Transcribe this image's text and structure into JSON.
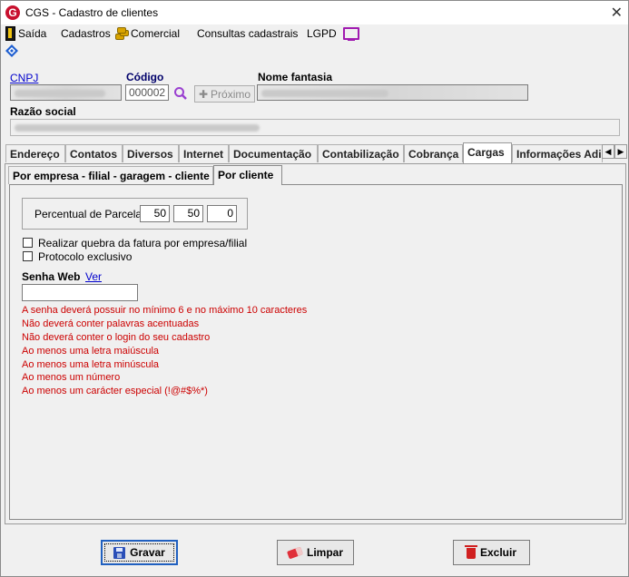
{
  "window": {
    "title": "CGS - Cadastro de clientes",
    "close_glyph": "✕",
    "logo_letter": "G"
  },
  "menu": {
    "items": [
      {
        "label": "Saída",
        "icon": "door-exit-icon"
      },
      {
        "label": "Cadastros"
      },
      {
        "label": "Comercial",
        "icon": "coins-icon"
      },
      {
        "label": "Consultas cadastrais"
      },
      {
        "label": "LGPD",
        "icon": "monitor-icon"
      }
    ]
  },
  "header": {
    "cnpj_label": "CNPJ",
    "codigo_label": "Código",
    "codigo_value": "000002",
    "proximo_label": "Próximo",
    "nome_fantasia_label": "Nome fantasia",
    "razao_social_label": "Razão social"
  },
  "tabs": {
    "items": [
      "Endereço",
      "Contatos",
      "Diversos",
      "Internet",
      "Documentação",
      "Contabilização",
      "Cobrança",
      "Cargas",
      "Informações Adi"
    ],
    "active": "Cargas",
    "scroll_left": "◀",
    "scroll_right": "▶"
  },
  "subtabs": {
    "items": [
      "Por empresa - filial - garagem - cliente",
      "Por cliente"
    ],
    "active": "Por cliente"
  },
  "cargas": {
    "percentual_label": "Percentual de Parcelas",
    "percentual_values": [
      "50",
      "50",
      "0"
    ],
    "quebra_fatura_label": "Realizar quebra da fatura por empresa/filial",
    "quebra_fatura_checked": false,
    "protocolo_label": "Protocolo exclusivo",
    "protocolo_checked": false,
    "senha_label": "Senha Web",
    "ver_link": "Ver",
    "senha_value": "",
    "rules": [
      "A senha deverá possuir no mínimo 6 e no máximo 10 caracteres",
      "Não deverá conter palavras acentuadas",
      "Não deverá conter o login do seu cadastro",
      "Ao menos uma letra maiúscula",
      "Ao menos uma letra minúscula",
      "Ao menos um número",
      "Ao menos um carácter especial (!@#$%*)"
    ],
    "rules_color": "#cc0000"
  },
  "buttons": {
    "gravar": "Gravar",
    "limpar": "Limpar",
    "excluir": "Excluir"
  }
}
